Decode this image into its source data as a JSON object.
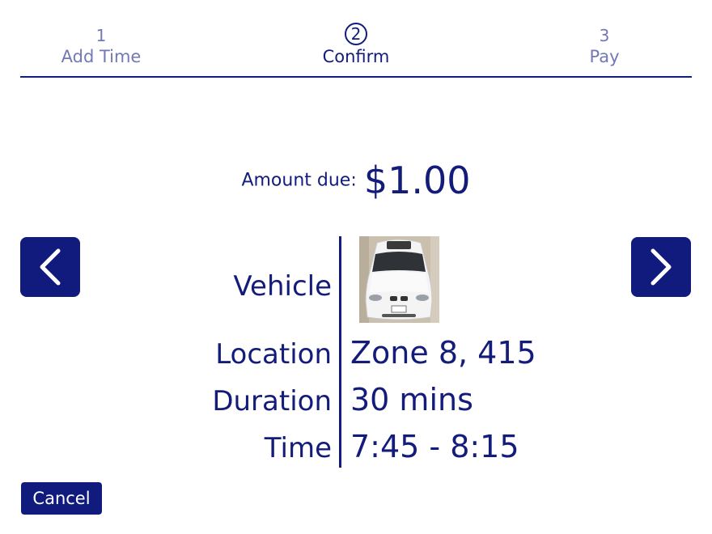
{
  "steps": [
    {
      "number": "1",
      "label": "Add Time",
      "active": false
    },
    {
      "number": "2",
      "label": "Confirm",
      "active": true
    },
    {
      "number": "3",
      "label": "Pay",
      "active": false
    }
  ],
  "amount": {
    "label": "Amount due:",
    "value": "$1.00"
  },
  "details": {
    "vehicle_label": "Vehicle",
    "location_label": "Location",
    "location_value": "Zone 8, 415",
    "duration_label": "Duration",
    "duration_value": "30 mins",
    "time_label": "Time",
    "time_value": "7:45 - 8:15"
  },
  "nav": {
    "prev_icon": "chevron-left-icon",
    "next_icon": "chevron-right-icon"
  },
  "cancel_label": "Cancel",
  "colors": {
    "primary": "#101b7d",
    "inactive_text": "#7279b4",
    "background": "#ffffff"
  }
}
